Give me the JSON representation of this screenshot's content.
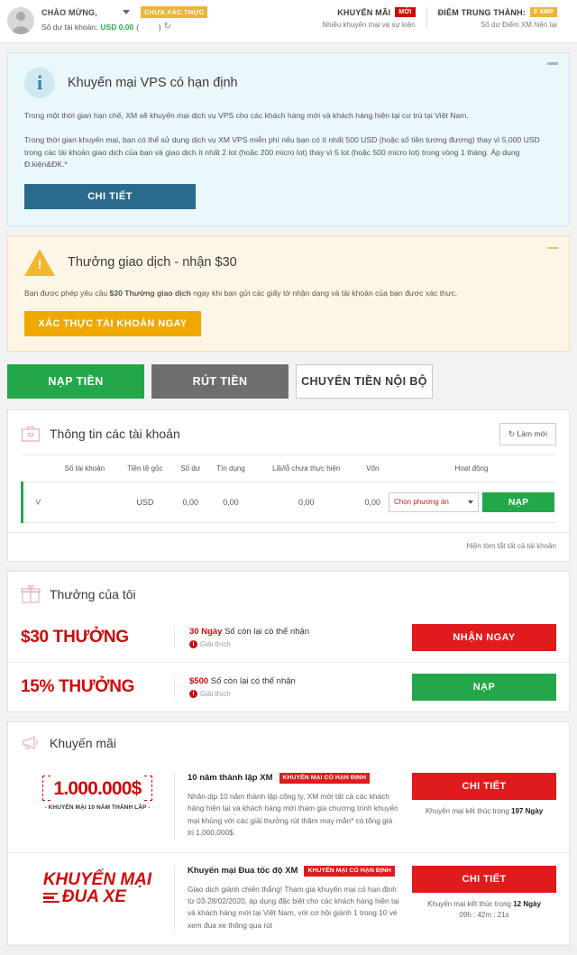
{
  "topbar": {
    "welcome": "CHÀO MỪNG,",
    "verify_badge": "CHƯA XÁC THỰC",
    "balance_label": "Số dư tài khoản:",
    "balance_value": "USD 0,00",
    "balance_paren_open": "(",
    "balance_paren_hidden": "··",
    "balance_paren_close": ")",
    "promo_title": "KHUYẾN MÃI",
    "promo_badge": "MỚI",
    "promo_sub": "Nhiều khuyến mại và sự kiện",
    "loyalty_title": "ĐIỂM TRUNG THÀNH:",
    "loyalty_badge": "0 XMP",
    "loyalty_sub": "Số dư Điểm XM hiện tại"
  },
  "banner_vps": {
    "icon": "info-icon",
    "title": "Khuyến mại VPS có hạn định",
    "p1": "Trong một thời gian hạn chế, XM sẽ khuyến mại dịch vụ VPS cho các khách hàng mới và khách hàng hiện tại cư trú tại Việt Nam.",
    "p2": "Trong thời gian khuyến mại, bạn có thể sử dụng dịch vụ XM VPS miễn phí nếu bạn có ít nhất 500 USD (hoặc số tiền tương đương) thay vì 5.000 USD trong các tài khoản giao dịch của bạn và giao dịch ít nhất 2 lot (hoặc 200 micro lot) thay vì 5 lot (hoặc 500 micro lot) trong vòng 1 tháng. Áp dụng Đ.kiện&ĐK.*",
    "button": "CHI TIẾT"
  },
  "banner_bonus": {
    "icon": "warning-icon",
    "title": "Thưởng giao dịch - nhận $30",
    "text_before": "Bạn được phép yêu cầu ",
    "text_bold": "$30 Thưởng giao dịch",
    "text_after": " ngay khi bạn gửi các giấy tờ nhận dạng và tài khoản của bạn được xác thực.",
    "button": "XÁC THỰC TÀI KHOẢN NGAY"
  },
  "actions": {
    "deposit": "NẠP TIỀN",
    "withdraw": "RÚT TIỀN",
    "transfer": "CHUYỂN TIỀN NỘI BỘ"
  },
  "accounts": {
    "title": "Thông tin các tài khoản",
    "refresh_label": "Làm mới",
    "columns": [
      "",
      "Số tài khoản",
      "Tiền tệ gốc",
      "Số dư",
      "Tín dụng",
      "Lãi/lỗ chưa thực hiện",
      "Vốn",
      "Hoạt động"
    ],
    "row": {
      "account_number": "",
      "currency": "USD",
      "balance": "0,00",
      "credit": "0,00",
      "unrealized": "0,00",
      "equity": "0,00",
      "select_value": "Chọn phương án",
      "action_button": "NẠP"
    },
    "footer": "Hiện tóm tắt tất cả tài khoản"
  },
  "bonus": {
    "title": "Thưởng của tôi",
    "rows": [
      {
        "amount": "$30 THƯỞNG",
        "highlight": "30 Ngày",
        "desc": " Số còn lại có thể nhận",
        "explain": "Giải thích",
        "button": "NHẬN NGAY",
        "button_color": "#e01b1b"
      },
      {
        "amount": "15% THƯỞNG",
        "highlight": "$500",
        "desc": " Số còn lại có thể nhận",
        "explain": "Giải thích",
        "button": "NẠP",
        "button_color": "#22a84a"
      }
    ]
  },
  "promotions": {
    "title": "Khuyến mãi",
    "items": [
      {
        "thumb_amount": "1.000.000$",
        "thumb_sub": "- KHUYẾN MẠI 10 NĂM THÀNH LẬP -",
        "title": "10 năm thành lập XM",
        "badge": "KHUYẾN MẠI CÓ HẠN ĐỊNH",
        "desc": "Nhân dịp 10 năm thành lập công ty, XM mời tất cả các khách hàng hiện tại và khách hàng mới tham gia chương trình khuyến mại khủng với các giải thưởng rút thăm may mắn* có tổng giá trị 1,000,000$.",
        "button": "CHI TIẾT",
        "countdown_label": "Khuyến mại kết thúc trong ",
        "countdown_days": "197 Ngày",
        "timer": ""
      },
      {
        "thumb_line1": "KHUYẾN MẠI",
        "thumb_line2": "ĐUA XE",
        "title": "Khuyến mại Đua tốc độ XM",
        "badge": "KHUYẾN MẠI CÓ HẠN ĐỊNH",
        "desc": "Giao dịch giành chiến thắng! Tham gia khuyến mại có hạn định từ 03-28/02/2020, áp dụng đặc biệt cho các khách hàng hiện tại và khách hàng mới tại Việt Nam, với cơ hội giành 1 trong 10 vé xem đua xe thông qua rút",
        "button": "CHI TIẾT",
        "countdown_label": "Khuyến mại kết thúc trong ",
        "countdown_days": "12 Ngày",
        "timer": "09h : 42m : 21s"
      }
    ]
  },
  "colors": {
    "green": "#22a84a",
    "red": "#e01b1b",
    "orange": "#f0a800",
    "blue": "#2a6b8c"
  }
}
